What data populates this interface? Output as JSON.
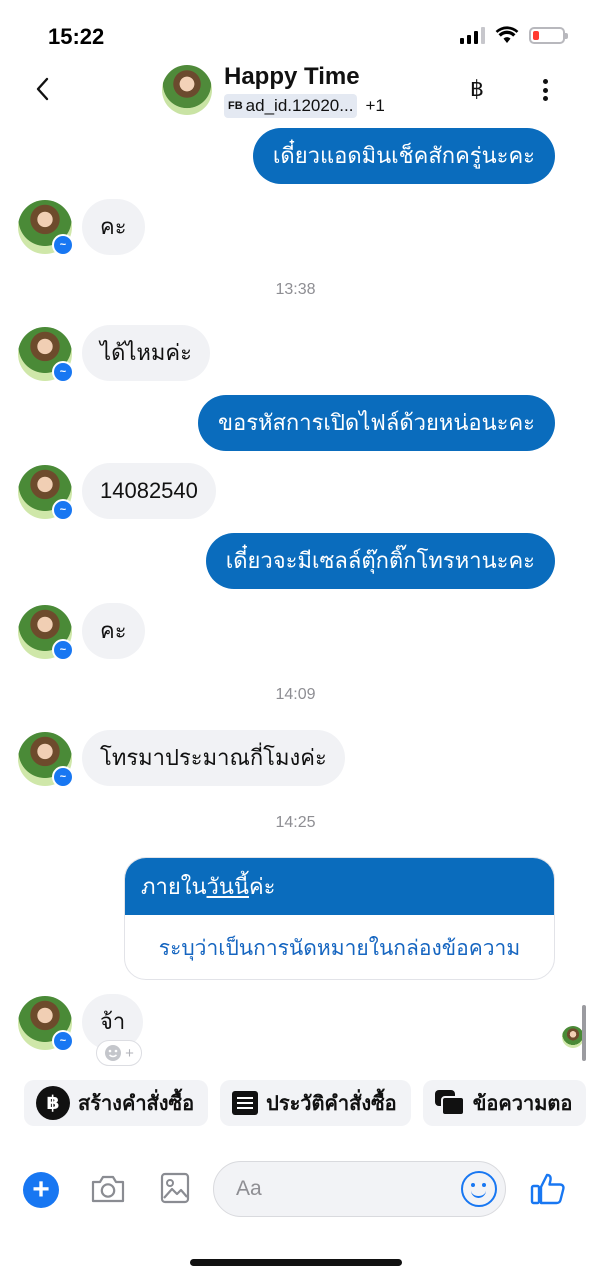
{
  "status_bar": {
    "time": "15:22"
  },
  "header": {
    "title": "Happy Time",
    "ad_tag_prefix": "FB",
    "ad_tag": "ad_id.12020...",
    "extra_count": "+1",
    "baht_symbol": "฿"
  },
  "messages": {
    "m1_out": "เดี๋ยวแอดมินเช็คสักครู่นะคะ",
    "m2_in": "คะ",
    "ts1": "13:38",
    "m3_in": "ได้ไหมค่ะ",
    "m4_out": "ขอรหัสการเปิดไฟล์ด้วยหน่อนะคะ",
    "m5_in": "14082540",
    "m6_out": "เดี๋ยวจะมีเซลล์ตุ๊กติ๊กโทรหานะคะ",
    "m7_in": "คะ",
    "ts2": "14:09",
    "m8_in": "โทรมาประมาณกี่โมงค่ะ",
    "ts3": "14:25",
    "card_prefix": "ภายใน",
    "card_underlined": "วันนี้",
    "card_suffix": "ค่ะ",
    "card_link": "ระบุว่าเป็นการนัดหมายในกล่องข้อความ",
    "m9_in": "จ้า"
  },
  "reaction_button": {
    "plus": "+"
  },
  "quick_actions": {
    "create_order": "สร้างคำสั่งซื้อ",
    "order_history": "ประวัติคำสั่งซื้อ",
    "saved_replies": "ข้อความตอ"
  },
  "composer": {
    "placeholder": "Aa",
    "plus": "+"
  },
  "colors": {
    "outgoing_bubble": "#0a6cbd",
    "incoming_bubble": "#f1f2f5",
    "accent": "#1877f2",
    "link": "#1565c0"
  },
  "icons": [
    "back-chevron-icon",
    "baht-icon",
    "more-vertical-icon",
    "messenger-badge-icon",
    "smiley-plus-icon",
    "camera-icon",
    "gallery-icon",
    "emoji-icon",
    "thumbs-up-icon",
    "document-list-icon",
    "chat-bubbles-icon"
  ]
}
